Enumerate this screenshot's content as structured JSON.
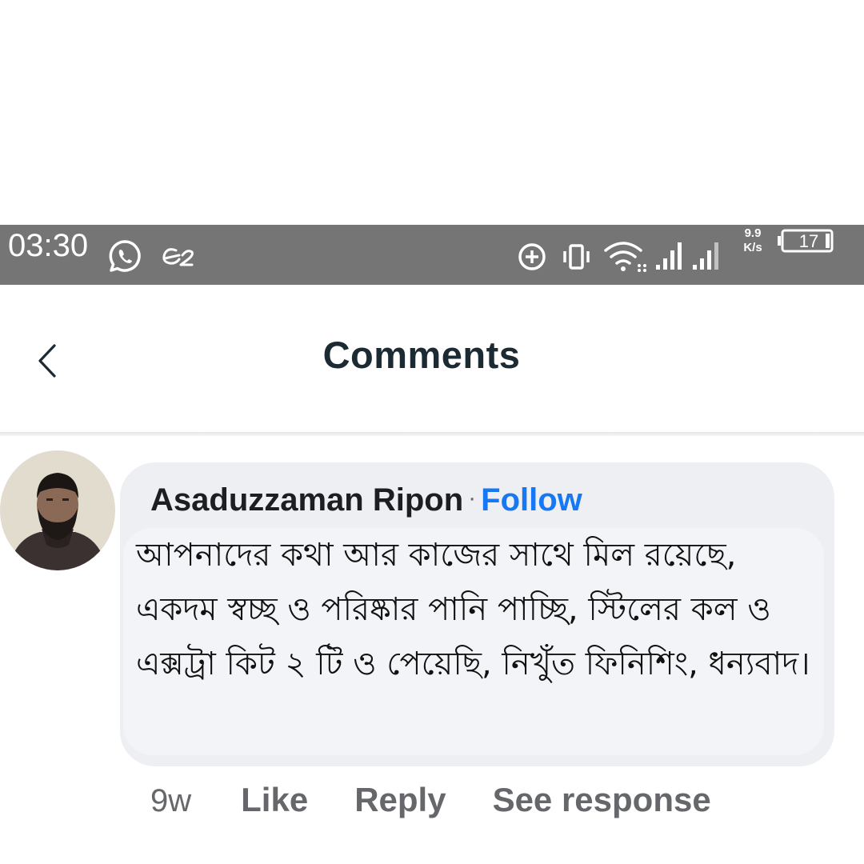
{
  "status_bar": {
    "time": "03:30",
    "net_speed_value": "9.9",
    "net_speed_unit": "K/s",
    "battery": "17",
    "icons": [
      "whatsapp-icon",
      "app-notification-icon",
      "data-saver-icon",
      "vibrate-icon",
      "wifi-icon",
      "signal-icon",
      "signal-icon",
      "battery-icon"
    ]
  },
  "header": {
    "title": "Comments",
    "back_icon": "chevron-left-icon"
  },
  "comment": {
    "author": "Asaduzzaman Ripon",
    "separator": "·",
    "follow_label": "Follow",
    "text": "আপনাদের কথা আর কাজের সাথে মিল রয়েছে, একদম স্বচ্ছ ও পরিষ্কার পানি পাচ্ছি, স্টিলের কল ও এক্সট্রা কিট ২ টি ও পেয়েছি, নিখুঁত ফিনিশিং, ধন্যবাদ।",
    "timestamp": "9w",
    "actions": {
      "like": "Like",
      "reply": "Reply",
      "see_response": "See response"
    }
  },
  "colors": {
    "status_bar_bg": "#757575",
    "title_text": "#1c2b33",
    "follow_link": "#1877f2",
    "bubble_bg": "#edeff3",
    "muted_text": "#65676b"
  }
}
